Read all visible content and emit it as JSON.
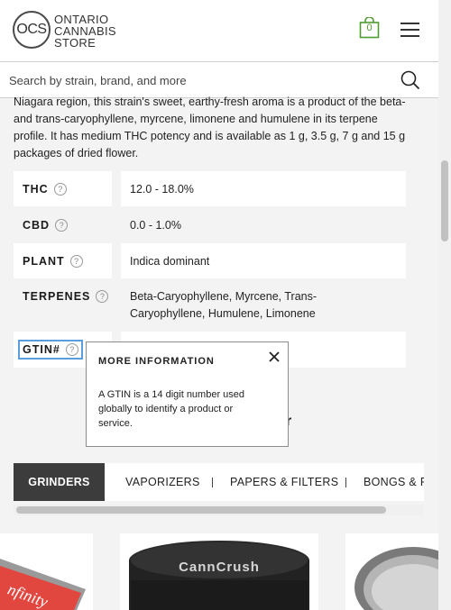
{
  "header": {
    "logo_mark": "OCS",
    "logo_lines": [
      "ONTARIO",
      "CANNABIS",
      "STORE"
    ],
    "cart_count": "0"
  },
  "search": {
    "placeholder": "Search by strain, brand, and more"
  },
  "description": {
    "lines": [
      "Niagara region, this strain's sweet, earthy-fresh aroma is a product of the beta-",
      "and trans-caryophyllene, myrcene, limonene and humulene in its terpene",
      "profile. It has medium THC potency and is available as 1 g, 3.5 g, 7 g and 15 g",
      "packages of dried flower."
    ]
  },
  "specs": [
    {
      "label": "THC",
      "value": "12.0 - 18.0%"
    },
    {
      "label": "CBD",
      "value": "0.0 - 1.0%"
    },
    {
      "label": "PLANT",
      "value": "Indica dominant"
    },
    {
      "label": "TERPENES",
      "value_lines": [
        "Beta-Caryophyllene, Myrcene, Trans-",
        "Caryophyllene, Humulene, Limonene"
      ]
    },
    {
      "label": "GTIN#",
      "value": ""
    }
  ],
  "help_glyph": "?",
  "tooltip": {
    "title": "MORE INFORMATION",
    "body_lines": [
      "A GTIN is a 14 digit number used",
      "globally to identify a product or",
      "service."
    ]
  },
  "partial_heading": "r",
  "tabs": [
    {
      "label": "GRINDERS",
      "active": true
    },
    {
      "label": "VAPORIZERS",
      "active": false
    },
    {
      "label": "PAPERS & FILTERS",
      "active": false
    },
    {
      "label": "BONGS & PI",
      "active": false
    }
  ],
  "products": {
    "left_card_text": "nfinity",
    "center_card_brand": "CannCrush"
  },
  "colors": {
    "cart_accent": "#4f9b32",
    "focus_ring": "#5b9ddf",
    "active_tab": "#3c3c3c"
  }
}
